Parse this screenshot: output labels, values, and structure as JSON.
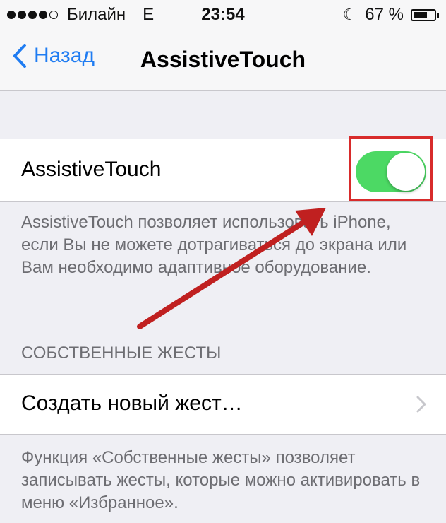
{
  "status_bar": {
    "carrier": "Билайн",
    "network": "E",
    "time": "23:54",
    "battery_text": "67 %",
    "battery_level": 0.67,
    "signal_bars_filled": 4
  },
  "nav": {
    "back_label": "Назад",
    "title": "AssistiveTouch"
  },
  "assistive_touch": {
    "label": "AssistiveTouch",
    "toggle_on": true,
    "toggle_color": "#4cd964",
    "description": "AssistiveTouch позволяет использовать iPhone, если Вы не можете дотрагиваться до экрана или Вам необходимо адаптивное оборудование."
  },
  "gestures": {
    "header": "СОБСТВЕННЫЕ ЖЕСТЫ",
    "create_label": "Создать новый жест…",
    "footer": "Функция «Собственные жесты» позволяет записывать жесты, которые можно активировать в меню «Избранное»."
  },
  "annotation": {
    "color": "#d82b2b"
  }
}
